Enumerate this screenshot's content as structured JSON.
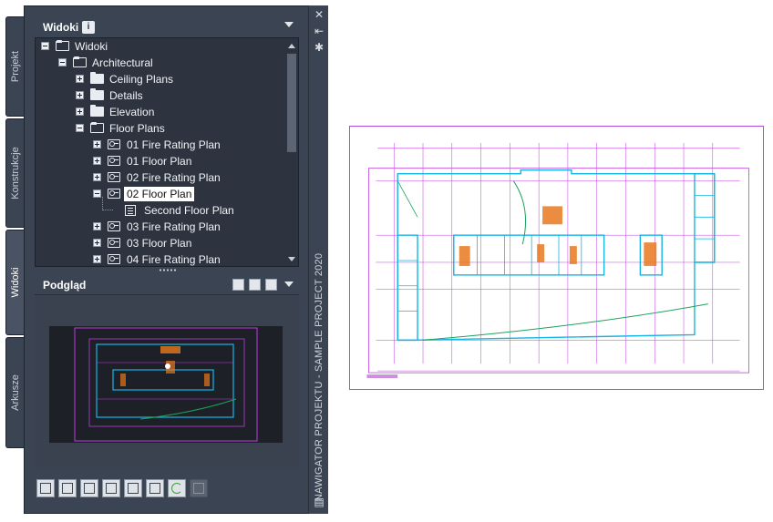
{
  "side_tabs": [
    {
      "label": "Projekt",
      "active": false
    },
    {
      "label": "Konstrukcje",
      "active": false
    },
    {
      "label": "Widoki",
      "active": true
    },
    {
      "label": "Arkusze",
      "active": false
    }
  ],
  "views_panel": {
    "title": "Widoki",
    "info_icon": "i",
    "tree": [
      {
        "label": "Widoki",
        "level": 0,
        "toggle": "minus",
        "icon": "folder-open"
      },
      {
        "label": "Architectural",
        "level": 1,
        "toggle": "minus",
        "icon": "folder-open"
      },
      {
        "label": "Ceiling Plans",
        "level": 2,
        "toggle": "plus",
        "icon": "folder"
      },
      {
        "label": "Details",
        "level": 2,
        "toggle": "plus",
        "icon": "folder"
      },
      {
        "label": "Elevation",
        "level": 2,
        "toggle": "plus",
        "icon": "folder"
      },
      {
        "label": "Floor Plans",
        "level": 2,
        "toggle": "minus",
        "icon": "folder-open"
      },
      {
        "label": "01 Fire Rating Plan",
        "level": 3,
        "toggle": "plus",
        "icon": "view"
      },
      {
        "label": "01 Floor Plan",
        "level": 3,
        "toggle": "plus",
        "icon": "view"
      },
      {
        "label": "02 Fire Rating Plan",
        "level": 3,
        "toggle": "plus",
        "icon": "view"
      },
      {
        "label": "02 Floor Plan",
        "level": 3,
        "toggle": "minus",
        "icon": "view",
        "selected": true
      },
      {
        "label": "Second Floor Plan",
        "level": 4,
        "toggle": "none",
        "icon": "sheet"
      },
      {
        "label": "03 Fire Rating Plan",
        "level": 3,
        "toggle": "plus",
        "icon": "view"
      },
      {
        "label": "03 Floor Plan",
        "level": 3,
        "toggle": "plus",
        "icon": "view"
      },
      {
        "label": "04 Fire Rating Plan",
        "level": 3,
        "toggle": "plus",
        "icon": "view"
      }
    ]
  },
  "preview_panel": {
    "title": "Podgląd"
  },
  "palette": {
    "vertical_title": "NAWIGATOR PROJEKTU - SAMPLE PROJECT 2020"
  },
  "toolbar": {
    "tools": [
      "add-view-icon",
      "edit-view-icon",
      "regenerate-icon",
      "clipboard-icon",
      "select-icon",
      "properties-icon",
      "refresh-icon",
      "repath-icon"
    ]
  },
  "colors": {
    "panel_bg": "#3b4453",
    "tree_bg": "#2d3440",
    "drawing_magenta": "#c03be0",
    "drawing_cyan": "#15b4e6",
    "drawing_green": "#1aa35a",
    "drawing_orange": "#e8781e"
  }
}
